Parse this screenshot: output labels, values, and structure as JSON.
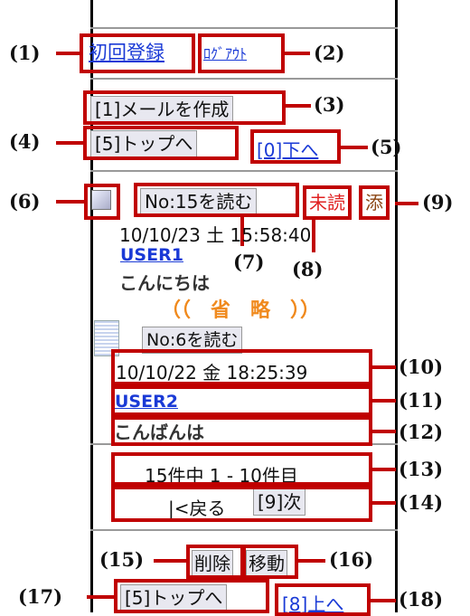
{
  "callouts": [
    "(1)",
    "(2)",
    "(3)",
    "(4)",
    "(5)",
    "(6)",
    "(7)",
    "(8)",
    "(9)",
    "(10)",
    "(11)",
    "(12)",
    "(13)",
    "(14)",
    "(15)",
    "(16)",
    "(17)",
    "(18)"
  ],
  "top": {
    "register_link": "初回登録",
    "logout_link": "ﾛｸﾞｱｳﾄ"
  },
  "menu": {
    "compose_button": "[1]メールを作成",
    "top_button": "[5]トップへ",
    "down_link": "[0]下へ"
  },
  "mail1": {
    "read_button": "No:15を読む",
    "unread_badge": "未読",
    "attach_badge": "添",
    "date": "10/10/23 土 15:58:40",
    "sender": "USER1",
    "subject": "こんにちは"
  },
  "omission": "（（　省　略　））",
  "mail2": {
    "read_button": "No:6を読む",
    "date": "10/10/22 金 18:25:39",
    "sender": "USER2",
    "subject": "こんばんは"
  },
  "pager": {
    "summary": "15件中 1 - 10件目",
    "prev": "|<戻る",
    "next_button": "[9]次"
  },
  "bottom": {
    "delete_button": "削除",
    "move_button": "移動",
    "top_button": "[5]トップへ",
    "up_link": "[8]上へ"
  },
  "colors": {
    "callout": "#c00000",
    "link": "#1a3ad6",
    "omission": "#f08a1e",
    "attach": "#8b4513"
  }
}
